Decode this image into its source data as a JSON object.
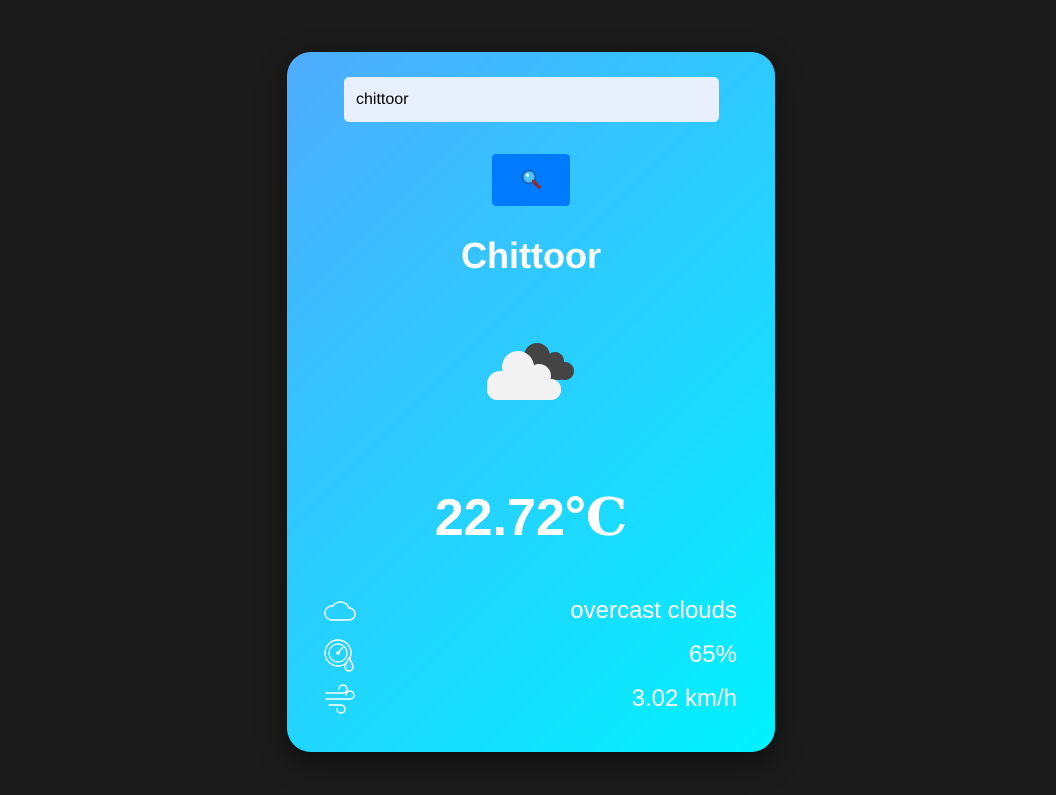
{
  "search": {
    "value": "chittoor",
    "button_icon": "magnifier-icon"
  },
  "weather": {
    "city": "Chittoor",
    "condition_icon": "broken-clouds-icon",
    "temperature": "22.72",
    "temperature_unit": "℃"
  },
  "details": [
    {
      "icon": "cloud-outline-icon",
      "value": "overcast clouds"
    },
    {
      "icon": "humidity-gauge-icon",
      "value": "65%"
    },
    {
      "icon": "wind-icon",
      "value": "3.02 km/h"
    }
  ],
  "colors": {
    "background": "#1b1b1b",
    "card_gradient_start": "#4facfe",
    "card_gradient_end": "#00f2fe",
    "search_button": "#007bff",
    "input_background": "#e8f0fe",
    "text": "#ffffff"
  }
}
